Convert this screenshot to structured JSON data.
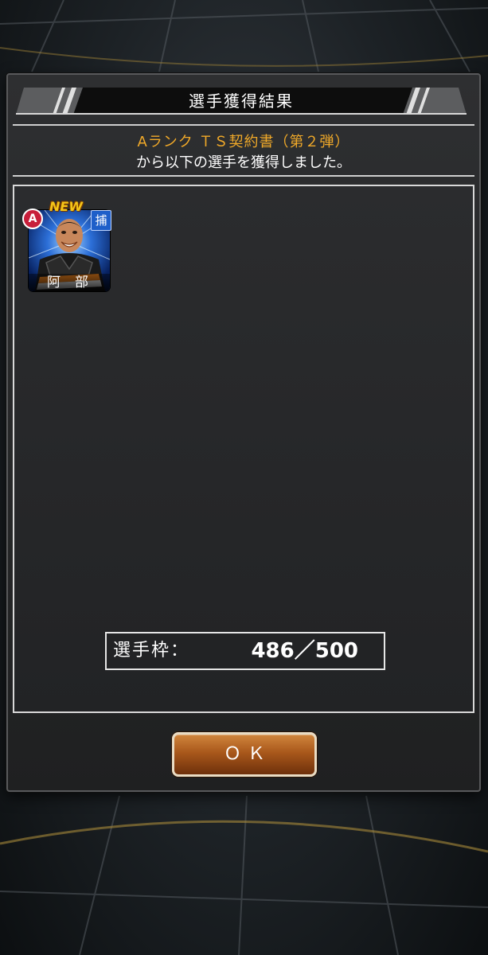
{
  "dialog": {
    "title": "選手獲得結果",
    "subtitle": "Aランク ＴＳ契約書（第２弾）",
    "message": "から以下の選手を獲得しました。"
  },
  "players": [
    {
      "name": "阿部",
      "rank": "A",
      "position": "捕",
      "badge": "NEW"
    }
  ],
  "capacity": {
    "label": "選手枠：",
    "value": "486／500"
  },
  "ok_button": {
    "label": "ＯＫ"
  },
  "colors": {
    "accent_orange": "#f0a929",
    "button_brown": "#a9581b",
    "rank_red": "#c81e3a",
    "position_blue": "#1e5fc9"
  }
}
